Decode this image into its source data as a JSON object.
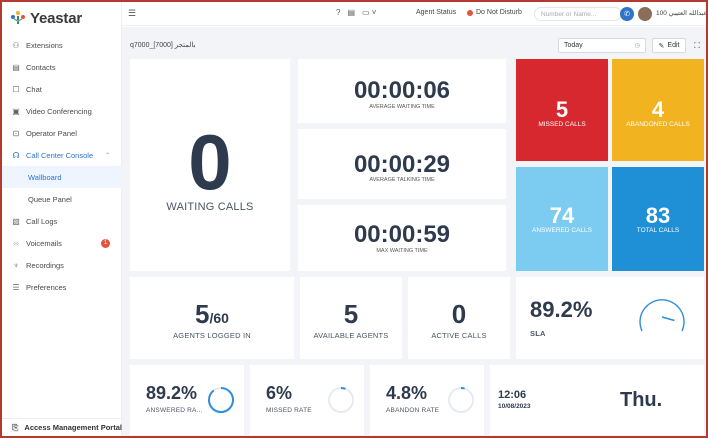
{
  "app": {
    "brand": "Yeastar"
  },
  "sidebar": {
    "items": [
      {
        "label": "Extensions",
        "icon": "extensions-icon",
        "glyph": "⚇"
      },
      {
        "label": "Contacts",
        "icon": "contacts-icon",
        "glyph": "▤"
      },
      {
        "label": "Chat",
        "icon": "chat-icon",
        "glyph": "☐"
      },
      {
        "label": "Video Conferencing",
        "icon": "video-icon",
        "glyph": "▣"
      },
      {
        "label": "Operator Panel",
        "icon": "operator-panel-icon",
        "glyph": "⊡"
      },
      {
        "label": "Call Center Console",
        "icon": "headset-icon",
        "glyph": "☊"
      },
      {
        "label": "Wallboard"
      },
      {
        "label": "Queue Panel"
      },
      {
        "label": "Call Logs",
        "icon": "call-logs-icon",
        "glyph": "▧"
      },
      {
        "label": "Voicemails",
        "icon": "voicemail-icon",
        "glyph": "◦◦",
        "badge": "1"
      },
      {
        "label": "Recordings",
        "icon": "microphone-icon",
        "glyph": "♆"
      },
      {
        "label": "Preferences",
        "icon": "preferences-icon",
        "glyph": "☰"
      }
    ],
    "portal": "Access Management Portal"
  },
  "topbar": {
    "agent_status": "Agent Status",
    "dnd": "Do Not Disturb",
    "search_placeholder": "Number or Name...",
    "user": "عبدالله العتيبي 100"
  },
  "wallboard": {
    "queue_title": "q7000_[7000] بالمتجر",
    "range": "Today",
    "edit": "Edit",
    "waiting_calls": {
      "value": "0",
      "label": "WAITING CALLS"
    },
    "avg_waiting_time": {
      "value": "00:00:06",
      "label": "AVERAGE WAITING TIME"
    },
    "avg_talking_time": {
      "value": "00:00:29",
      "label": "AVERAGE TALKING TIME"
    },
    "max_waiting_time": {
      "value": "00:00:59",
      "label": "MAX WAITING TIME"
    },
    "missed_calls": {
      "value": "5",
      "label": "MISSED CALLS",
      "color": "#d7282f"
    },
    "abandoned_calls": {
      "value": "4",
      "label": "ABANDONED CALLS",
      "color": "#f2b320"
    },
    "answered_calls": {
      "value": "74",
      "label": "ANSWERED CALLS",
      "color": "#7ccbf0"
    },
    "total_calls": {
      "value": "83",
      "label": "TOTAL CALLS",
      "color": "#1f8fd6"
    },
    "agents_logged_in": {
      "value": "5",
      "total": "/60",
      "label": "AGENTS LOGGED IN"
    },
    "available_agents": {
      "value": "5",
      "label": "AVAILABLE AGENTS"
    },
    "active_calls": {
      "value": "0",
      "label": "ACTIVE CALLS"
    },
    "sla": {
      "value": "89.2%",
      "label": "SLA",
      "fraction": 0.892
    },
    "answered_rate": {
      "value": "89.2%",
      "label": "ANSWERED RA...",
      "fraction": 0.892
    },
    "missed_rate": {
      "value": "6%",
      "label": "MISSED RATE",
      "fraction": 0.06
    },
    "abandon_rate": {
      "value": "4.8%",
      "label": "ABANDON RATE",
      "fraction": 0.048
    },
    "clock": {
      "time": "12:06",
      "date": "10/08/2023",
      "day": "Thu."
    }
  }
}
